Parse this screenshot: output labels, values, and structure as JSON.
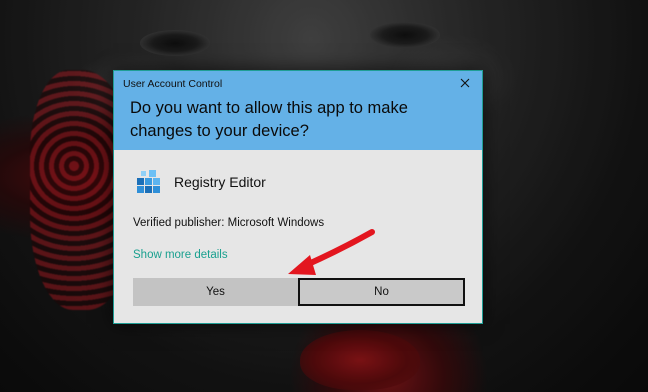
{
  "dialog": {
    "title": "User Account Control",
    "question": "Do you want to allow this app to make changes to your device?",
    "app_name": "Registry Editor",
    "app_icon": "registry-editor-icon",
    "publisher": "Verified publisher: Microsoft Windows",
    "more_details": "Show more details",
    "yes_label": "Yes",
    "no_label": "No",
    "close_icon": "close-icon"
  },
  "colors": {
    "header": "#64b1e7",
    "body": "#e6e6e6",
    "border": "#1f9e95",
    "link": "#1aa08f",
    "arrow": "#e3161f"
  }
}
